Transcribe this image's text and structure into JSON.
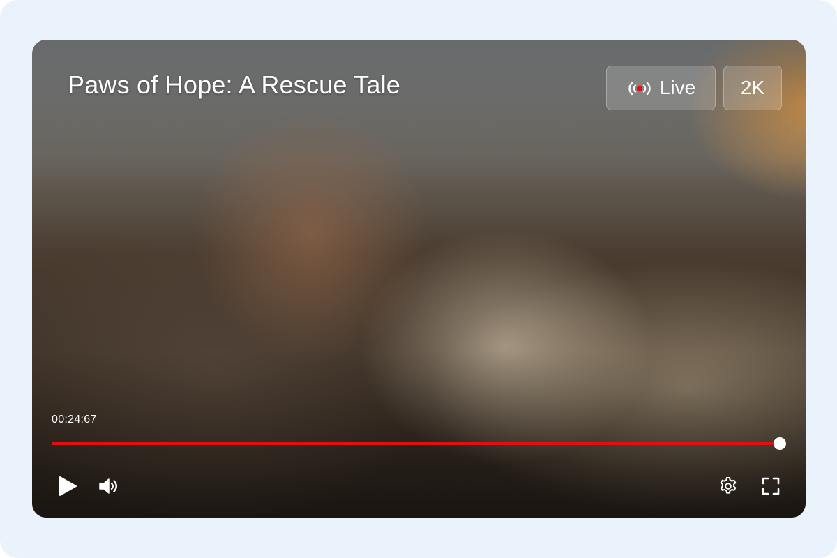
{
  "video": {
    "title": "Paws of Hope: A Rescue Tale",
    "live_label": "Live",
    "quality_label": "2K",
    "current_time": "00:24:67",
    "progress_fraction": 0.997
  },
  "controls": {
    "play_icon": "play-icon",
    "volume_icon": "volume-icon",
    "settings_icon": "gear-icon",
    "fullscreen_icon": "fullscreen-icon",
    "live_icon": "live-broadcast-icon"
  },
  "colors": {
    "accent": "#e01010",
    "background": "#eaf2fc",
    "live_dot": "#e01010"
  }
}
